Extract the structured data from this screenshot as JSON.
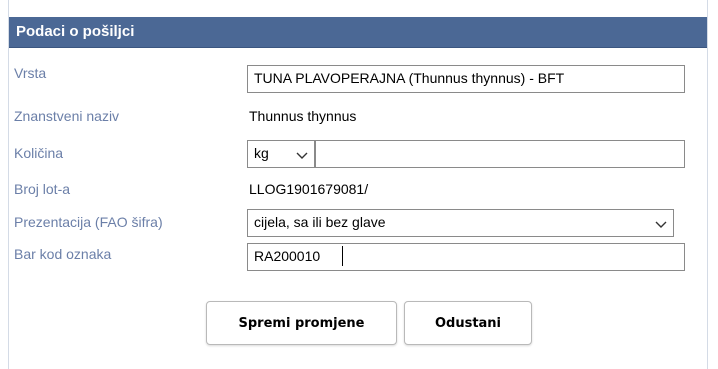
{
  "panel": {
    "title": "Podaci o pošiljci"
  },
  "fields": {
    "vrsta": {
      "label": "Vrsta",
      "value": "TUNA PLAVOPERAJNA (Thunnus thynnus) - BFT"
    },
    "znanstveni_naziv": {
      "label": "Znanstveni naziv",
      "value": "Thunnus thynnus"
    },
    "kolicina": {
      "label": "Količina",
      "unit": "kg",
      "value": ""
    },
    "broj_lota": {
      "label": "Broj lot-a",
      "value": "LLOG1901679081/"
    },
    "prezentacija": {
      "label": "Prezentacija (FAO šifra)",
      "value": "cijela, sa ili bez glave"
    },
    "bar_kod": {
      "label": "Bar kod oznaka",
      "value": "RA200010"
    }
  },
  "buttons": {
    "save_label": "Spremi promjene",
    "cancel_label": "Odustani"
  },
  "colors": {
    "header_bg": "#4b6895",
    "label": "#6b7fa8"
  }
}
